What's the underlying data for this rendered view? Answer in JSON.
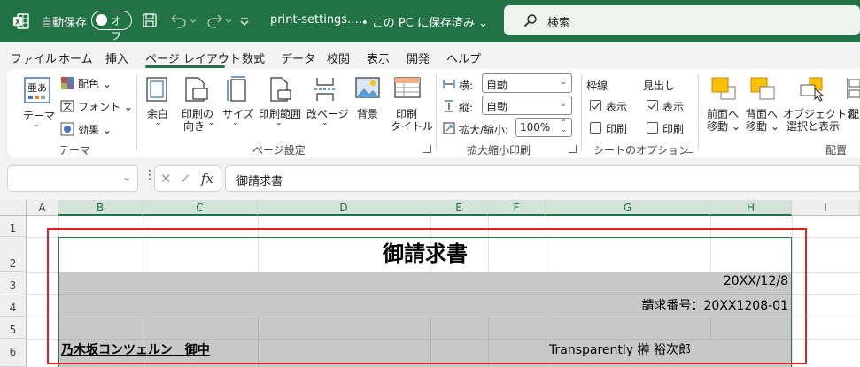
{
  "titlebar": {
    "autosave_label": "自動保存",
    "autosave_state": "オフ",
    "filename": "print-settings.…",
    "save_status": "• この PC に保存済み ⌄",
    "search_placeholder": "検索"
  },
  "tabs": [
    "ファイル",
    "ホーム",
    "挿入",
    "ページ レイアウト",
    "数式",
    "データ",
    "校閲",
    "表示",
    "開発",
    "ヘルプ"
  ],
  "active_tab": "ページ レイアウト",
  "ribbon": {
    "theme": {
      "theme_label": "テーマ",
      "colors": "配色 ⌄",
      "fonts": "フォント ⌄",
      "effects": "効果 ⌄",
      "group": "テーマ"
    },
    "page_setup": {
      "margins": "余白",
      "orientation_1": "印刷の",
      "orientation_2": "向き",
      "size": "サイズ",
      "print_area": "印刷範囲",
      "breaks": "改ページ",
      "background": "背景",
      "print_titles_1": "印刷",
      "print_titles_2": "タイトル",
      "group": "ページ設定"
    },
    "scale": {
      "width_label": "横:",
      "width_value": "自動",
      "height_label": "縦:",
      "height_value": "自動",
      "scale_label": "拡大/縮小:",
      "scale_value": "100%",
      "group": "拡大縮小印刷"
    },
    "sheet_options": {
      "gridlines": "枠線",
      "headings": "見出し",
      "view": "表示",
      "print": "印刷",
      "group": "シートのオプション"
    },
    "arrange": {
      "bring_forward_1": "前面へ",
      "bring_forward_2": "移動 ⌄",
      "send_backward_1": "背面へ",
      "send_backward_2": "移動 ⌄",
      "selection_pane_1": "オブジェクトの",
      "selection_pane_2": "選択と表示",
      "align": "配",
      "group": "配置"
    }
  },
  "formula_bar": {
    "name_box": "",
    "fx": "fx",
    "formula": "御請求書"
  },
  "grid": {
    "columns": [
      "A",
      "B",
      "C",
      "D",
      "E",
      "F",
      "G",
      "H",
      "I"
    ],
    "rows": [
      "1",
      "2",
      "3",
      "4",
      "5",
      "6"
    ],
    "title": "御請求書",
    "date": "20XX/12/8",
    "invoice_no": "請求番号：20XX1208-01",
    "customer": "乃木坂コンツェルン　御中",
    "sender": "Transparently 榊 裕次郎"
  }
}
